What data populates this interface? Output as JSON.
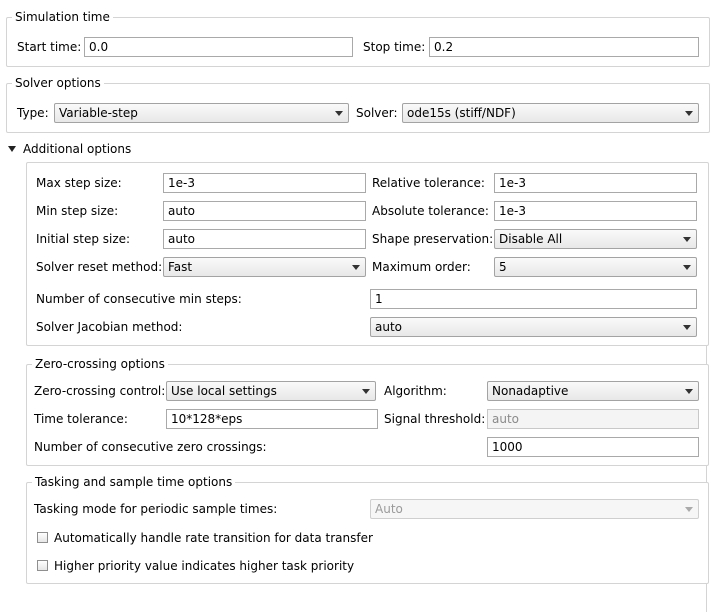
{
  "simulation_time": {
    "title": "Simulation time",
    "start_label": "Start time:",
    "start_value": "0.0",
    "stop_label": "Stop time:",
    "stop_value": "0.2"
  },
  "solver_options": {
    "title": "Solver options",
    "type_label": "Type:",
    "type_value": "Variable-step",
    "solver_label": "Solver:",
    "solver_value": "ode15s (stiff/NDF)"
  },
  "additional_options": {
    "title": "Additional options",
    "max_step_label": "Max step size:",
    "max_step_value": "1e-3",
    "min_step_label": "Min step size:",
    "min_step_value": "auto",
    "initial_step_label": "Initial step size:",
    "initial_step_value": "auto",
    "reset_method_label": "Solver reset method:",
    "reset_method_value": "Fast",
    "rel_tol_label": "Relative tolerance:",
    "rel_tol_value": "1e-3",
    "abs_tol_label": "Absolute tolerance:",
    "abs_tol_value": "1e-3",
    "shape_label": "Shape preservation:",
    "shape_value": "Disable All",
    "max_order_label": "Maximum order:",
    "max_order_value": "5",
    "consec_min_label": "Number of consecutive min steps:",
    "consec_min_value": "1",
    "jacobian_label": "Solver Jacobian method:",
    "jacobian_value": "auto"
  },
  "zero_crossing": {
    "title": "Zero-crossing options",
    "control_label": "Zero-crossing control:",
    "control_value": "Use local settings",
    "algorithm_label": "Algorithm:",
    "algorithm_value": "Nonadaptive",
    "time_tol_label": "Time tolerance:",
    "time_tol_value": "10*128*eps",
    "signal_threshold_label": "Signal threshold:",
    "signal_threshold_value": "auto",
    "consec_zc_label": "Number of consecutive zero crossings:",
    "consec_zc_value": "1000"
  },
  "tasking": {
    "title": "Tasking and sample time options",
    "mode_label": "Tasking mode for periodic sample times:",
    "mode_value": "Auto",
    "rate_transition_label": "Automatically handle rate transition for data transfer",
    "priority_label": "Higher priority value indicates higher task priority"
  }
}
